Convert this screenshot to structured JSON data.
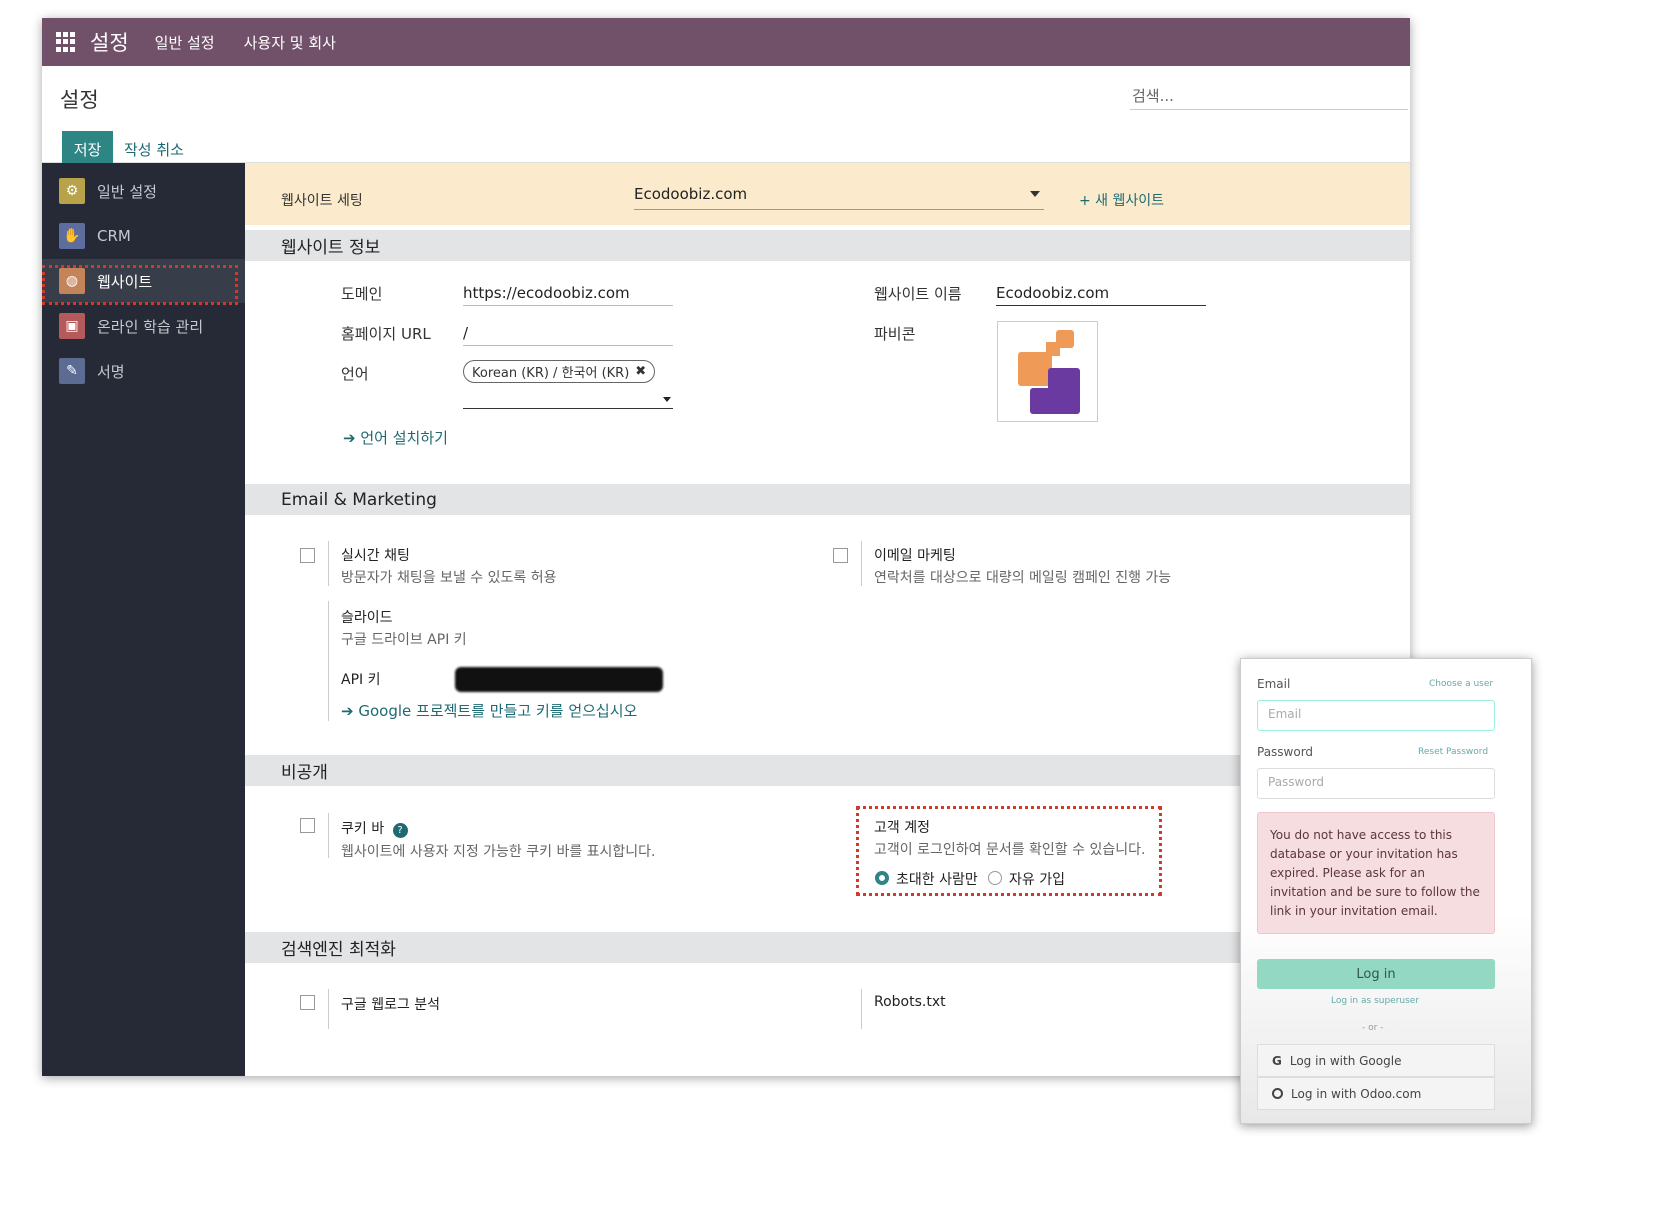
{
  "topbar": {
    "app_title": "설정",
    "menu1": "일반 설정",
    "menu2": "사용자 및 회사"
  },
  "control_panel": {
    "title": "설정",
    "search_placeholder": "검색...",
    "save": "저장",
    "discard": "작성 취소"
  },
  "sidebar": {
    "items": [
      {
        "label": "일반 설정",
        "icon": "gear-icon",
        "color": "#b9a34a"
      },
      {
        "label": "CRM",
        "icon": "handshake-icon",
        "color": "#5d6d9e"
      },
      {
        "label": "웹사이트",
        "icon": "globe-icon",
        "color": "#c4845a"
      },
      {
        "label": "온라인 학습 관리",
        "icon": "elearning-icon",
        "color": "#b55a5a"
      },
      {
        "label": "서명",
        "icon": "sign-icon",
        "color": "#5c6b92"
      }
    ]
  },
  "website_bar": {
    "label": "웹사이트 세팅",
    "selected": "Ecodoobiz.com",
    "new_link": "+ 새 웹사이트"
  },
  "website_info": {
    "header": "웹사이트 정보",
    "domain_label": "도메인",
    "domain_value": "https://ecodoobiz.com",
    "homepage_label": "홈페이지 URL",
    "homepage_value": "/",
    "language_label": "언어",
    "language_tag": "Korean (KR) / 한국어 (KR)",
    "install_lang_link": "언어 설치하기",
    "name_label": "웹사이트 이름",
    "name_value": "Ecodoobiz.com",
    "favicon_label": "파비콘"
  },
  "email_marketing": {
    "header": "Email & Marketing",
    "livechat_title": "실시간 채팅",
    "livechat_desc": "방문자가 채팅을 보낼 수 있도록 허용",
    "emailmkt_title": "이메일 마케팅",
    "emailmkt_desc": "연락처를 대상으로 대량의 메일링 캠페인 진행 가능",
    "slides_title": "슬라이드",
    "slides_desc": "구글 드라이브 API 키",
    "apikey_label": "API 키",
    "google_link": "Google 프로젝트를 만들고 키를 얻으십시오"
  },
  "privacy": {
    "header": "비공개",
    "cookie_title": "쿠키 바",
    "cookie_desc": "웹사이트에 사용자 지정 가능한 쿠키 바를 표시합니다.",
    "customer_title": "고객 계정",
    "customer_desc": "고객이 로그인하여 문서를 확인할 수 있습니다.",
    "opt_invited": "초대한 사람만",
    "opt_free": "자유 가입"
  },
  "seo": {
    "header": "검색엔진 최적화",
    "ga_title": "구글 웹로그 분석",
    "robots_title": "Robots.txt"
  },
  "login": {
    "email_label": "Email",
    "choose_user": "Choose a user",
    "email_placeholder": "Email",
    "password_label": "Password",
    "reset_password": "Reset Password",
    "password_placeholder": "Password",
    "error": "You do not have access to this database or your invitation has expired. Please ask for an invitation and be sure to follow the link in your invitation email.",
    "login_button": "Log in",
    "superuser": "Log in as superuser",
    "or": "- or -",
    "google": "Log in with Google",
    "odoo": "Log in with Odoo.com"
  },
  "colors": {
    "topbar": "#71516a",
    "accent": "#2d8584",
    "link": "#1e6a73",
    "highlight": "#d0392b"
  }
}
